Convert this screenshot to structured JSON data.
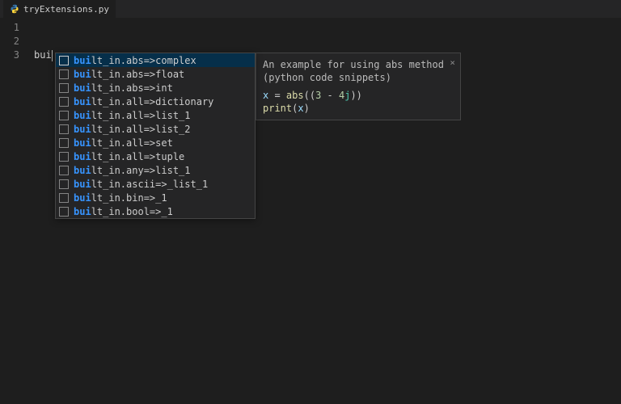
{
  "tab": {
    "filename": "tryExtensions.py"
  },
  "editor": {
    "lines": [
      "1",
      "2",
      "3"
    ],
    "typed_text": "bui",
    "match_prefix": "bui"
  },
  "autocomplete": {
    "items": [
      {
        "prefix": "bui",
        "rest": "lt_in.abs=>complex",
        "selected": true
      },
      {
        "prefix": "bui",
        "rest": "lt_in.abs=>float",
        "selected": false
      },
      {
        "prefix": "bui",
        "rest": "lt_in.abs=>int",
        "selected": false
      },
      {
        "prefix": "bui",
        "rest": "lt_in.all=>dictionary",
        "selected": false
      },
      {
        "prefix": "bui",
        "rest": "lt_in.all=>list_1",
        "selected": false
      },
      {
        "prefix": "bui",
        "rest": "lt_in.all=>list_2",
        "selected": false
      },
      {
        "prefix": "bui",
        "rest": "lt_in.all=>set",
        "selected": false
      },
      {
        "prefix": "bui",
        "rest": "lt_in.all=>tuple",
        "selected": false
      },
      {
        "prefix": "bui",
        "rest": "lt_in.any=>list_1",
        "selected": false
      },
      {
        "prefix": "bui",
        "rest": "lt_in.ascii=>_list_1",
        "selected": false
      },
      {
        "prefix": "bui",
        "rest": "lt_in.bin=>_1",
        "selected": false
      },
      {
        "prefix": "bui",
        "rest": "lt_in.bool=>_1",
        "selected": false
      }
    ]
  },
  "tooltip": {
    "description": "An example for using abs method (python code snippets)",
    "snippet": {
      "line1": {
        "var": "x",
        "assign": " = ",
        "func": "abs",
        "open": "((",
        "num1": "3",
        "dash": " - ",
        "num2": "4",
        "j": "j",
        "close": "))"
      },
      "line2": {
        "func": "print",
        "open": "(",
        "var": "x",
        "close": ")"
      }
    }
  }
}
